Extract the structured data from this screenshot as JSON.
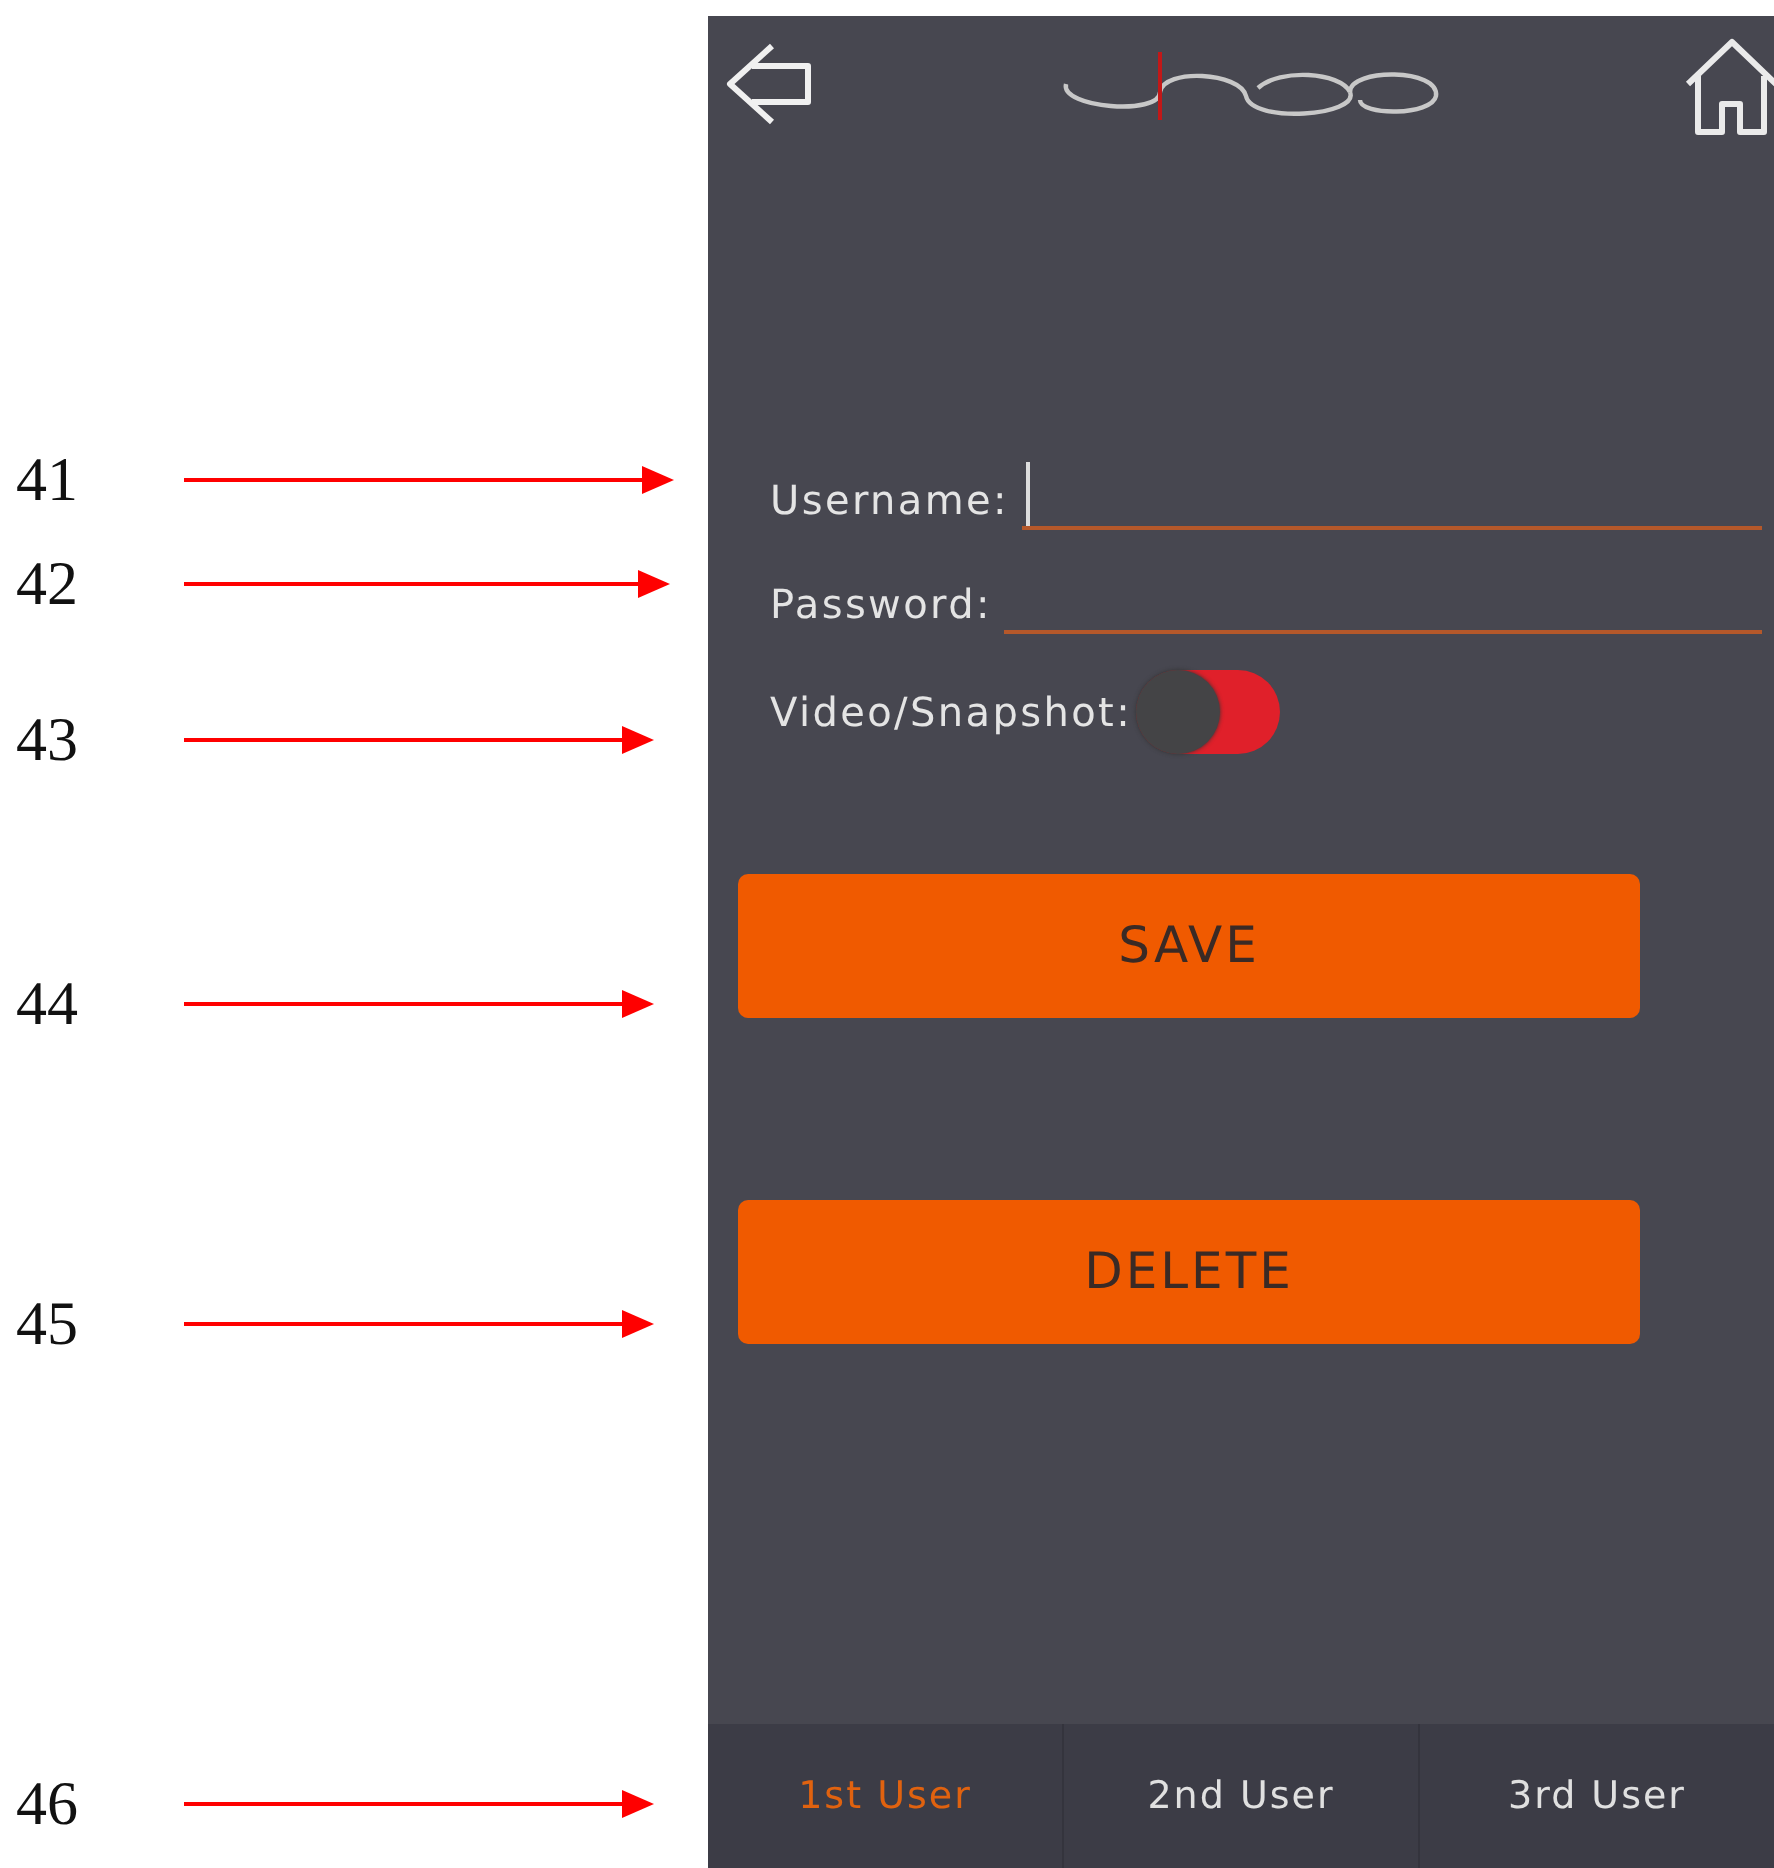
{
  "callouts": [
    {
      "label": "41"
    },
    {
      "label": "42"
    },
    {
      "label": "43"
    },
    {
      "label": "44"
    },
    {
      "label": "45"
    },
    {
      "label": "46"
    }
  ],
  "form": {
    "username": {
      "label": "Username:",
      "focused": true
    },
    "password": {
      "label": "Password:",
      "focused": false
    },
    "video_snapshot": {
      "label": "Video/Snapshot:",
      "on": true
    }
  },
  "buttons": [
    {
      "label": "SAVE"
    },
    {
      "label": "DELETE"
    }
  ],
  "tabs": [
    {
      "label": "1st User",
      "selected": true
    },
    {
      "label": "2nd User",
      "selected": false
    },
    {
      "label": "3rd User",
      "selected": false
    }
  ]
}
